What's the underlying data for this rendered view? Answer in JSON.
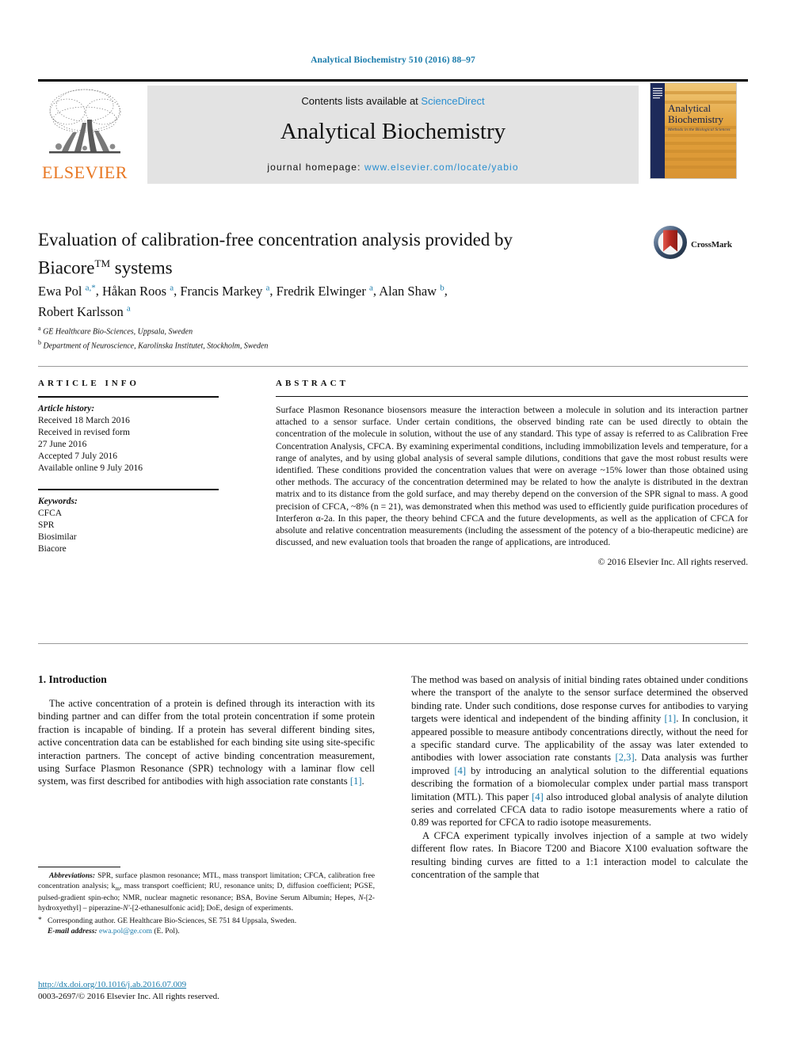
{
  "running_head": "Analytical Biochemistry 510 (2016) 88–97",
  "masthead": {
    "contents_prefix": "Contents lists available at ",
    "sciencedirect": "ScienceDirect",
    "journal_title": "Analytical Biochemistry",
    "homepage_prefix": "journal homepage: ",
    "homepage_url": "www.elsevier.com/locate/yabio",
    "publisher_wordmark": "ELSEVIER",
    "publisher_logo_icon": "elsevier-tree-icon",
    "cover_title_line1": "Analytical",
    "cover_title_line2": "Biochemistry",
    "cover_subtitle": "Methods in the Biological Sciences"
  },
  "article": {
    "title": "Evaluation of calibration-free concentration analysis provided by Biacore™ systems",
    "title_line1": "Evaluation of calibration-free concentration analysis provided by",
    "title_line2_main": "Biacore",
    "title_line2_tm": "TM",
    "title_line2_rest": " systems",
    "authors": [
      {
        "name": "Ewa Pol",
        "marks": "a,*"
      },
      {
        "name": "Håkan Roos",
        "marks": "a"
      },
      {
        "name": "Francis Markey",
        "marks": "a"
      },
      {
        "name": "Fredrik Elwinger",
        "marks": "a"
      },
      {
        "name": "Alan Shaw",
        "marks": "b"
      },
      {
        "name": "Robert Karlsson",
        "marks": "a"
      }
    ],
    "affiliations": [
      {
        "mark": "a",
        "text": "GE Healthcare Bio-Sciences, Uppsala, Sweden"
      },
      {
        "mark": "b",
        "text": "Department of Neuroscience, Karolinska Institutet, Stockholm, Sweden"
      }
    ],
    "crossmark_label": "CrossMark",
    "crossmark_icon": "crossmark-icon"
  },
  "article_info": {
    "heading": "ARTICLE INFO",
    "history_label": "Article history:",
    "history": [
      "Received 18 March 2016",
      "Received in revised form",
      "27 June 2016",
      "Accepted 7 July 2016",
      "Available online 9 July 2016"
    ],
    "keywords_label": "Keywords:",
    "keywords": [
      "CFCA",
      "SPR",
      "Biosimilar",
      "Biacore"
    ]
  },
  "abstract": {
    "heading": "ABSTRACT",
    "text": "Surface Plasmon Resonance biosensors measure the interaction between a molecule in solution and its interaction partner attached to a sensor surface. Under certain conditions, the observed binding rate can be used directly to obtain the concentration of the molecule in solution, without the use of any standard. This type of assay is referred to as Calibration Free Concentration Analysis, CFCA. By examining experimental conditions, including immobilization levels and temperature, for a range of analytes, and by using global analysis of several sample dilutions, conditions that gave the most robust results were identified. These conditions provided the concentration values that were on average ~15% lower than those obtained using other methods. The accuracy of the concentration determined may be related to how the analyte is distributed in the dextran matrix and to its distance from the gold surface, and may thereby depend on the conversion of the SPR signal to mass. A good precision of CFCA, ~8% (n = 21), was demonstrated when this method was used to efficiently guide purification procedures of Interferon α-2a. In this paper, the theory behind CFCA and the future developments, as well as the application of CFCA for absolute and relative concentration measurements (including the assessment of the potency of a bio-therapeutic medicine) are discussed, and new evaluation tools that broaden the range of applications, are introduced.",
    "copyright": "© 2016 Elsevier Inc. All rights reserved."
  },
  "body": {
    "section_heading": "1. Introduction",
    "left_paragraph_1_a": "The active concentration of a protein is defined through its interaction with its binding partner and can differ from the total protein concentration if some protein fraction is incapable of binding. If a protein has several different binding sites, active concentration data can be established for each binding site using site-specific interaction partners. The concept of active binding concentration measurement, using Surface Plasmon Resonance (SPR) technology with a laminar flow cell system, was first described for antibodies with high association rate constants ",
    "left_paragraph_1_ref": "[1]",
    "left_paragraph_1_end": ".",
    "right_p1_a": "The method was based on analysis of initial binding rates obtained under conditions where the transport of the analyte to the sensor surface determined the observed binding rate. Under such conditions, dose response curves for antibodies to varying targets were identical and independent of the binding affinity ",
    "right_p1_ref1": "[1]",
    "right_p1_b": ". In conclusion, it appeared possible to measure antibody concentrations directly, without the need for a specific standard curve. The applicability of the assay was later extended to antibodies with lower association rate constants ",
    "right_p1_ref2": "[2,3]",
    "right_p1_c": ". Data analysis was further improved ",
    "right_p1_ref3": "[4]",
    "right_p1_d": " by introducing an analytical solution to the differential equations describing the formation of a biomolecular complex under partial mass transport limitation (MTL). This paper ",
    "right_p1_ref4": "[4]",
    "right_p1_e": " also introduced global analysis of analyte dilution series and correlated CFCA data to radio isotope measurements where a ratio of 0.89 was reported for CFCA to radio isotope measurements.",
    "right_p2": "A CFCA experiment typically involves injection of a sample at two widely different flow rates. In Biacore T200 and Biacore X100 evaluation software the resulting binding curves are fitted to a 1:1 interaction model to calculate the concentration of the sample that"
  },
  "footnotes": {
    "abbrev_label": "Abbreviations:",
    "abbrev_part1": " SPR, surface plasmon resonance; MTL, mass transport limitation; CFCA, calibration free concentration analysis; k",
    "abbrev_sub1": "m",
    "abbrev_part2": ", mass transport coefficient; RU, resonance units; D, diffusion coefficient; PGSE, pulsed-gradient spin-echo; NMR, nuclear magnetic resonance; BSA, Bovine Serum Albumin; Hepes, ",
    "abbrev_italic1": "N",
    "abbrev_part3": "-[2-hydroxyethyl] – piperazine-",
    "abbrev_italic2": "N'",
    "abbrev_part4": "-[2-ethanesulfonic acid]; DoE, design of experiments.",
    "corresponding_star": "*",
    "corresponding_text": "Corresponding author. GE Healthcare Bio-Sciences, SE 751 84 Uppsala, Sweden.",
    "email_label": "E-mail address:",
    "email": "ewa.pol@ge.com",
    "email_suffix": " (E. Pol).",
    "doi_url": "http://dx.doi.org/10.1016/j.ab.2016.07.009",
    "issn_line": "0003-2697/© 2016 Elsevier Inc. All rights reserved."
  },
  "colors": {
    "link_blue": "#1a7bab",
    "sciencedirect_blue": "#2a8fd0",
    "elsevier_orange": "#E87722",
    "masthead_grey": "#e3e3e3",
    "crossmark_red": "#b5271f",
    "cover_navy": "#1d2a5a",
    "cover_orange": "#e5a33a"
  }
}
